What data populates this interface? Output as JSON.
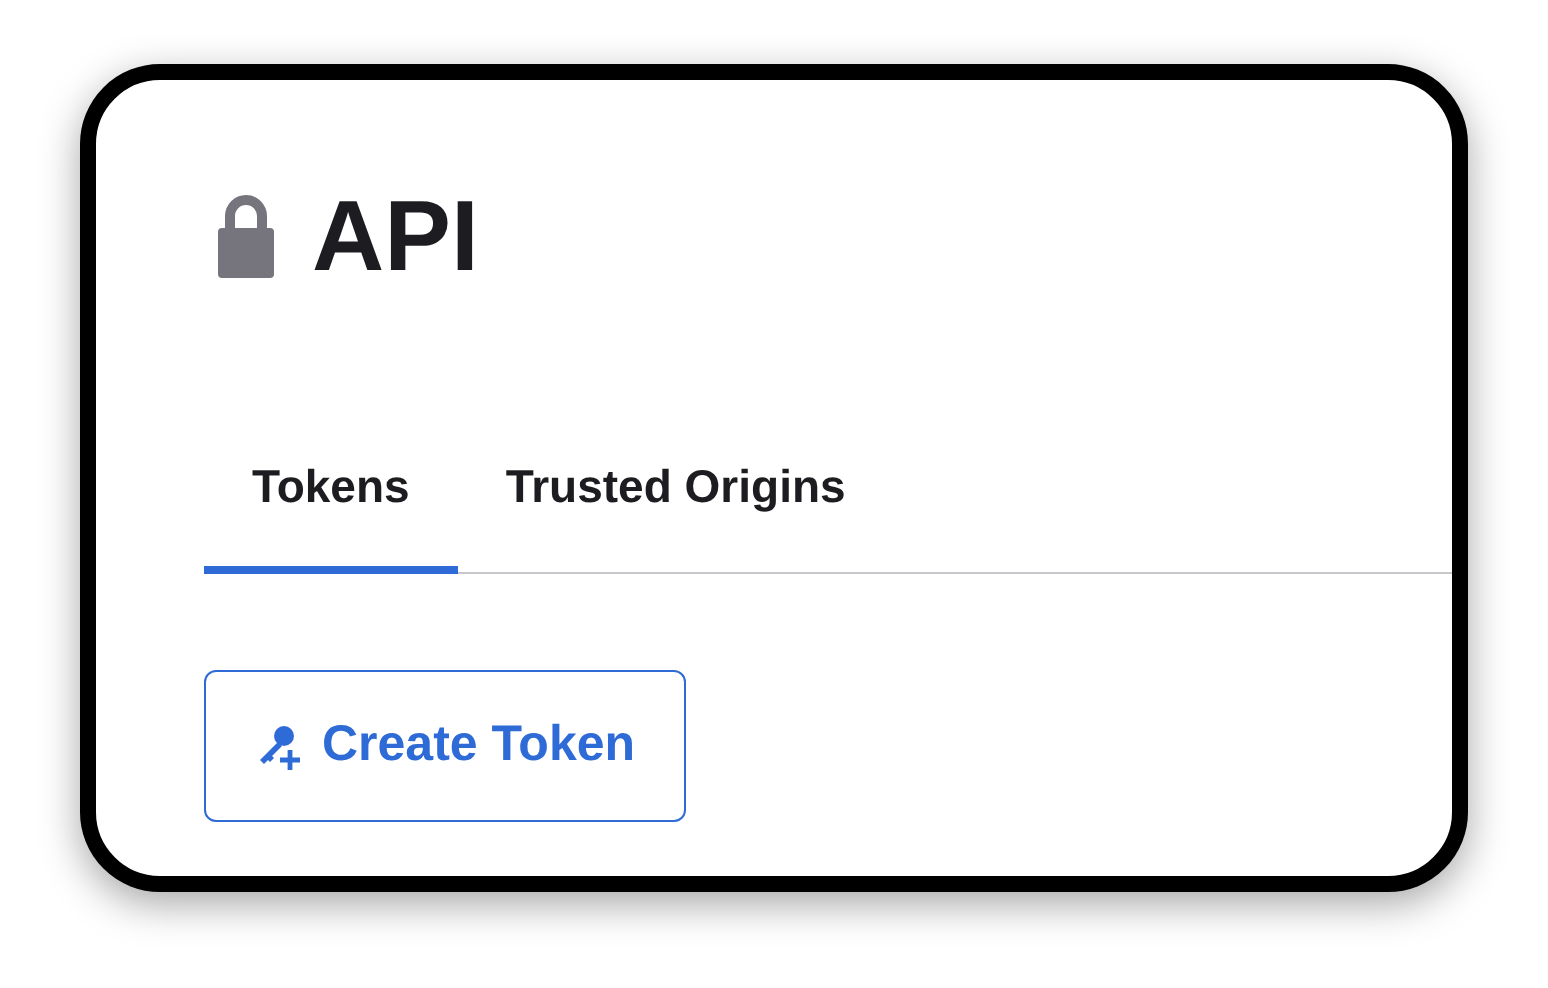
{
  "page": {
    "title": "API"
  },
  "tabs": [
    {
      "label": "Tokens",
      "selected": true
    },
    {
      "label": "Trusted Origins",
      "selected": false
    }
  ],
  "buttons": [
    {
      "label": "Create Token"
    }
  ]
}
